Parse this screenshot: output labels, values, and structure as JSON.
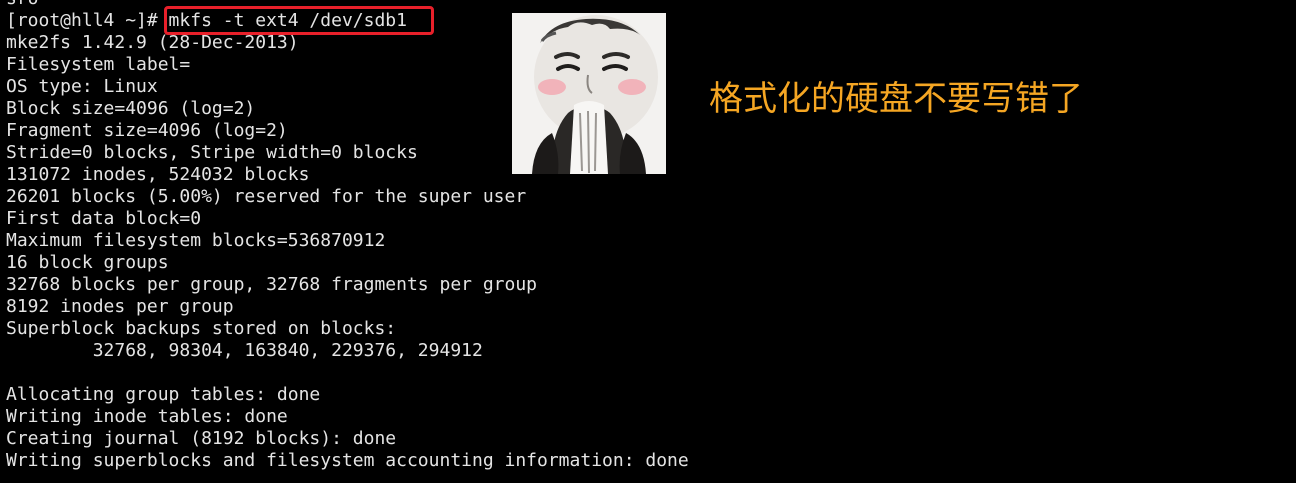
{
  "terminal": {
    "lines": [
      "sro",
      "[root@hll4 ~]# mkfs -t ext4 /dev/sdb1",
      "mke2fs 1.42.9 (28-Dec-2013)",
      "Filesystem label=",
      "OS type: Linux",
      "Block size=4096 (log=2)",
      "Fragment size=4096 (log=2)",
      "Stride=0 blocks, Stripe width=0 blocks",
      "131072 inodes, 524032 blocks",
      "26201 blocks (5.00%) reserved for the super user",
      "First data block=0",
      "Maximum filesystem blocks=536870912",
      "16 block groups",
      "32768 blocks per group, 32768 fragments per group",
      "8192 inodes per group",
      "Superblock backups stored on blocks:",
      "        32768, 98304, 163840, 229376, 294912",
      "",
      "Allocating group tables: done",
      "Writing inode tables: done",
      "Creating journal (8192 blocks): done",
      "Writing superblocks and filesystem accounting information: done"
    ]
  },
  "annotation": {
    "caption": "格式化的硬盘不要写错了",
    "caption_color": "#f5a623",
    "highlight_color": "#e8202a"
  },
  "meme": {
    "icon": "panda-face-meme-icon"
  }
}
